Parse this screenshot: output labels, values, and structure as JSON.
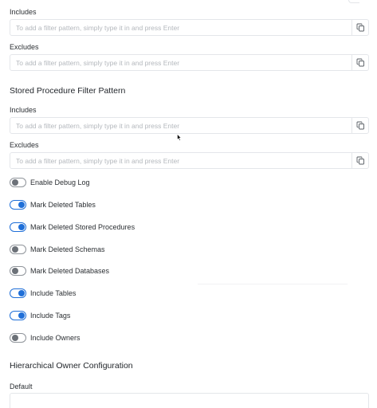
{
  "database_filter": {
    "includes_label": "Includes",
    "includes_placeholder": "To add a filter pattern, simply type it in and press Enter",
    "excludes_label": "Excludes",
    "excludes_placeholder": "To add a filter pattern, simply type it in and press Enter"
  },
  "stored_procedure_filter": {
    "title": "Stored Procedure Filter Pattern",
    "includes_label": "Includes",
    "includes_placeholder": "To add a filter pattern, simply type it in and press Enter",
    "excludes_label": "Excludes",
    "excludes_placeholder": "To add a filter pattern, simply type it in and press Enter"
  },
  "toggles": [
    {
      "label": "Enable Debug Log",
      "on": false
    },
    {
      "label": "Mark Deleted Tables",
      "on": true
    },
    {
      "label": "Mark Deleted Stored Procedures",
      "on": true
    },
    {
      "label": "Mark Deleted Schemas",
      "on": false
    },
    {
      "label": "Mark Deleted Databases",
      "on": false
    },
    {
      "label": "Include Tables",
      "on": true
    },
    {
      "label": "Include Tags",
      "on": true
    },
    {
      "label": "Include Owners",
      "on": false
    }
  ],
  "hierarchical_owner": {
    "title": "Hierarchical Owner Configuration",
    "default_label": "Default"
  },
  "colors": {
    "toggle_on": "#1f6fd8",
    "toggle_off": "#6c7178",
    "border": "#e4e6ea",
    "placeholder": "#b4b8bd"
  }
}
